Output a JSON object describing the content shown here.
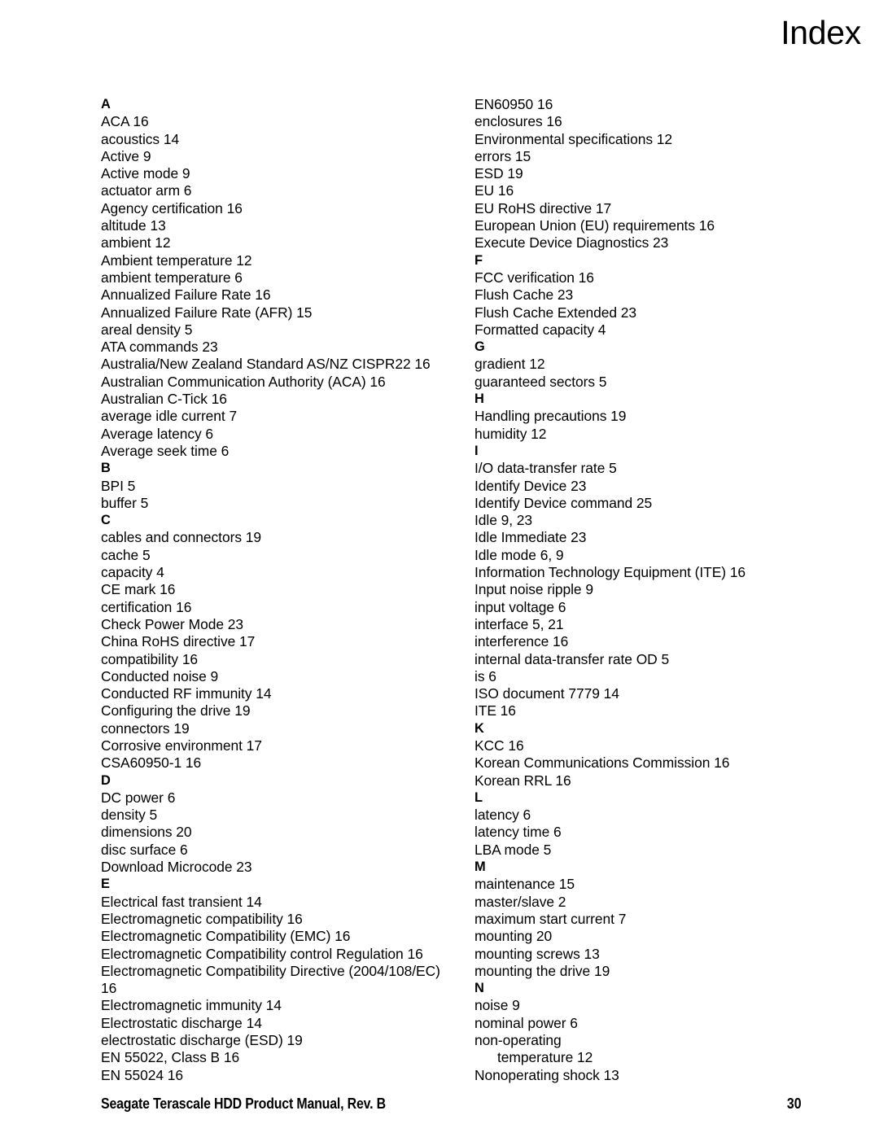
{
  "header": {
    "title": "Index"
  },
  "index": {
    "left_column": [
      {
        "text": "A",
        "type": "letter"
      },
      {
        "text": "ACA 16",
        "type": "entry"
      },
      {
        "text": "acoustics 14",
        "type": "entry"
      },
      {
        "text": "Active 9",
        "type": "entry"
      },
      {
        "text": "Active mode 9",
        "type": "entry"
      },
      {
        "text": "actuator arm 6",
        "type": "entry"
      },
      {
        "text": "Agency certification 16",
        "type": "entry"
      },
      {
        "text": "altitude 13",
        "type": "entry"
      },
      {
        "text": "ambient 12",
        "type": "entry"
      },
      {
        "text": "Ambient temperature 12",
        "type": "entry"
      },
      {
        "text": "ambient temperature 6",
        "type": "entry"
      },
      {
        "text": "Annualized Failure Rate 16",
        "type": "entry"
      },
      {
        "text": "Annualized Failure Rate (AFR) 15",
        "type": "entry"
      },
      {
        "text": "areal density 5",
        "type": "entry"
      },
      {
        "text": "ATA commands 23",
        "type": "entry"
      },
      {
        "text": "Australia/New Zealand Standard AS/NZ CISPR22 16",
        "type": "entry"
      },
      {
        "text": "Australian Communication Authority (ACA) 16",
        "type": "entry"
      },
      {
        "text": "Australian C-Tick 16",
        "type": "entry"
      },
      {
        "text": "average idle current 7",
        "type": "entry"
      },
      {
        "text": "Average latency 6",
        "type": "entry"
      },
      {
        "text": "Average seek time 6",
        "type": "entry"
      },
      {
        "text": "B",
        "type": "letter"
      },
      {
        "text": "BPI 5",
        "type": "entry"
      },
      {
        "text": "buffer 5",
        "type": "entry"
      },
      {
        "text": "C",
        "type": "letter"
      },
      {
        "text": "cables and connectors 19",
        "type": "entry"
      },
      {
        "text": "cache 5",
        "type": "entry"
      },
      {
        "text": "capacity 4",
        "type": "entry"
      },
      {
        "text": "CE mark 16",
        "type": "entry"
      },
      {
        "text": "certification 16",
        "type": "entry"
      },
      {
        "text": "Check Power Mode 23",
        "type": "entry"
      },
      {
        "text": "China RoHS directive 17",
        "type": "entry"
      },
      {
        "text": "compatibility 16",
        "type": "entry"
      },
      {
        "text": "Conducted noise 9",
        "type": "entry"
      },
      {
        "text": "Conducted RF immunity 14",
        "type": "entry"
      },
      {
        "text": "Configuring the drive 19",
        "type": "entry"
      },
      {
        "text": "connectors 19",
        "type": "entry"
      },
      {
        "text": "Corrosive environment 17",
        "type": "entry"
      },
      {
        "text": "CSA60950-1 16",
        "type": "entry"
      },
      {
        "text": "D",
        "type": "letter"
      },
      {
        "text": "DC power 6",
        "type": "entry"
      },
      {
        "text": "density 5",
        "type": "entry"
      },
      {
        "text": "dimensions 20",
        "type": "entry"
      },
      {
        "text": "disc surface 6",
        "type": "entry"
      },
      {
        "text": "Download Microcode 23",
        "type": "entry"
      },
      {
        "text": "E",
        "type": "letter"
      },
      {
        "text": "Electrical fast transient 14",
        "type": "entry"
      },
      {
        "text": "Electromagnetic compatibility 16",
        "type": "entry"
      },
      {
        "text": "Electromagnetic Compatibility (EMC) 16",
        "type": "entry"
      },
      {
        "text": "Electromagnetic Compatibility control Regulation 16",
        "type": "entry"
      },
      {
        "text": "Electromagnetic Compatibility Directive (2004/108/EC)",
        "type": "entry"
      },
      {
        "text": "16",
        "type": "cont"
      },
      {
        "text": "Electromagnetic immunity 14",
        "type": "entry"
      },
      {
        "text": "Electrostatic discharge 14",
        "type": "entry"
      },
      {
        "text": "electrostatic discharge (ESD) 19",
        "type": "entry"
      },
      {
        "text": "EN 55022, Class B 16",
        "type": "entry"
      },
      {
        "text": "EN 55024 16",
        "type": "entry"
      }
    ],
    "right_column": [
      {
        "text": "EN60950 16",
        "type": "entry"
      },
      {
        "text": "enclosures 16",
        "type": "entry"
      },
      {
        "text": "Environmental specifications 12",
        "type": "entry"
      },
      {
        "text": "errors 15",
        "type": "entry"
      },
      {
        "text": "ESD 19",
        "type": "entry"
      },
      {
        "text": "EU 16",
        "type": "entry"
      },
      {
        "text": "EU RoHS directive 17",
        "type": "entry"
      },
      {
        "text": "European Union (EU) requirements 16",
        "type": "entry"
      },
      {
        "text": "Execute Device Diagnostics 23",
        "type": "entry"
      },
      {
        "text": "F",
        "type": "letter"
      },
      {
        "text": "FCC verification 16",
        "type": "entry"
      },
      {
        "text": "Flush Cache 23",
        "type": "entry"
      },
      {
        "text": "Flush Cache Extended 23",
        "type": "entry"
      },
      {
        "text": "Formatted capacity 4",
        "type": "entry"
      },
      {
        "text": "G",
        "type": "letter"
      },
      {
        "text": "gradient 12",
        "type": "entry"
      },
      {
        "text": "guaranteed sectors 5",
        "type": "entry"
      },
      {
        "text": "H",
        "type": "letter"
      },
      {
        "text": "Handling precautions 19",
        "type": "entry"
      },
      {
        "text": "humidity 12",
        "type": "entry"
      },
      {
        "text": "I",
        "type": "letter"
      },
      {
        "text": "I/O data-transfer rate 5",
        "type": "entry"
      },
      {
        "text": "Identify Device 23",
        "type": "entry"
      },
      {
        "text": "Identify Device command 25",
        "type": "entry"
      },
      {
        "text": "Idle 9, 23",
        "type": "entry"
      },
      {
        "text": "Idle Immediate 23",
        "type": "entry"
      },
      {
        "text": "Idle mode 6, 9",
        "type": "entry"
      },
      {
        "text": "Information Technology Equipment (ITE) 16",
        "type": "entry"
      },
      {
        "text": "Input noise ripple 9",
        "type": "entry"
      },
      {
        "text": "input voltage 6",
        "type": "entry"
      },
      {
        "text": "interface 5, 21",
        "type": "entry"
      },
      {
        "text": "interference 16",
        "type": "entry"
      },
      {
        "text": "internal data-transfer rate OD 5",
        "type": "entry"
      },
      {
        "text": "is 6",
        "type": "entry"
      },
      {
        "text": "ISO document 7779 14",
        "type": "entry"
      },
      {
        "text": "ITE 16",
        "type": "entry"
      },
      {
        "text": "K",
        "type": "letter"
      },
      {
        "text": "KCC 16",
        "type": "entry"
      },
      {
        "text": "Korean Communications Commission 16",
        "type": "entry"
      },
      {
        "text": "Korean RRL 16",
        "type": "entry"
      },
      {
        "text": "L",
        "type": "letter"
      },
      {
        "text": "latency 6",
        "type": "entry"
      },
      {
        "text": "latency time 6",
        "type": "entry"
      },
      {
        "text": "LBA mode 5",
        "type": "entry"
      },
      {
        "text": "M",
        "type": "letter"
      },
      {
        "text": "maintenance 15",
        "type": "entry"
      },
      {
        "text": "master/slave 2",
        "type": "entry"
      },
      {
        "text": "maximum start current 7",
        "type": "entry"
      },
      {
        "text": "mounting 20",
        "type": "entry"
      },
      {
        "text": "mounting screws 13",
        "type": "entry"
      },
      {
        "text": "mounting the drive 19",
        "type": "entry"
      },
      {
        "text": "N",
        "type": "letter"
      },
      {
        "text": "noise 9",
        "type": "entry"
      },
      {
        "text": "nominal power 6",
        "type": "entry"
      },
      {
        "text": "non-operating",
        "type": "entry"
      },
      {
        "text": "temperature 12",
        "type": "sub"
      },
      {
        "text": "Nonoperating shock 13",
        "type": "entry"
      }
    ]
  },
  "footer": {
    "document_title": "Seagate Terascale HDD Product Manual, Rev. B",
    "page_number": "30"
  }
}
